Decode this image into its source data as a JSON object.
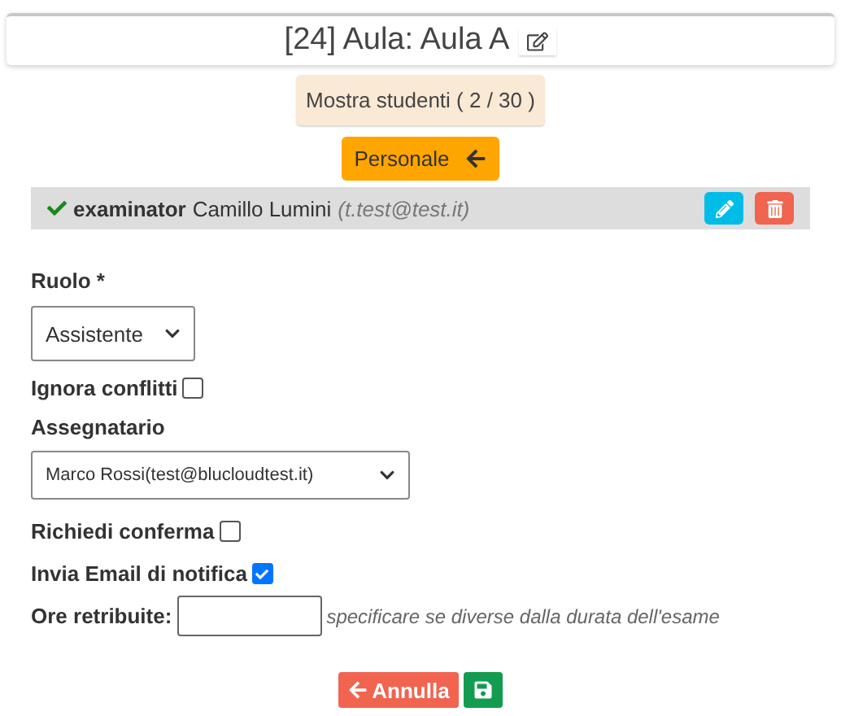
{
  "header": {
    "title": "[24] Aula: Aula A"
  },
  "students_button": "Mostra studenti ( 2 / 30 )",
  "staff_button": "Personale",
  "person": {
    "confirmed": true,
    "role": "examinator",
    "name": "Camillo Lumini",
    "email": "(t.test@test.it)"
  },
  "form": {
    "role": {
      "label": "Ruolo *",
      "value": "Assistente"
    },
    "ignore_conflicts": {
      "label": "Ignora conflitti",
      "checked": false
    },
    "assignee": {
      "label": "Assegnatario",
      "value": "Marco Rossi(test@blucloudtest.it)"
    },
    "require_confirmation": {
      "label": "Richiedi conferma",
      "checked": false
    },
    "send_email": {
      "label": "Invia Email di notifica",
      "checked": true
    },
    "paid_hours": {
      "label": "Ore retribuite:",
      "hint": "specificare se diverse dalla durata dell'esame"
    }
  },
  "actions": {
    "cancel": "Annulla"
  }
}
